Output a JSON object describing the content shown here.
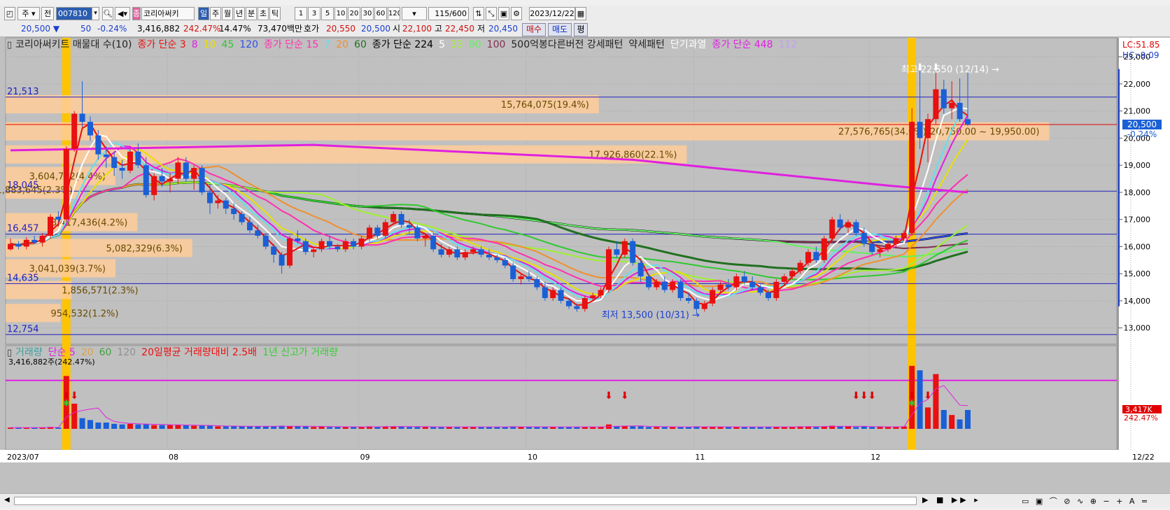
{
  "toolbar": {
    "period": "주",
    "mode": "전",
    "code": "007810",
    "name": "코리아써키",
    "timeframes": [
      "일",
      "주",
      "월",
      "년",
      "분",
      "초",
      "틱"
    ],
    "numbers": [
      "1",
      "3",
      "5",
      "10",
      "20",
      "30",
      "60",
      "120"
    ],
    "count": "115",
    "count_total": "/600",
    "date": "2023/12/22"
  },
  "quote": {
    "price": "20,500",
    "change": "50",
    "change_pct": "-0.24%",
    "volume": "3,416,882",
    "vol_ratio": "242.47%",
    "turnover": "14.47%",
    "amount": "73,470백만",
    "hoga_label": "호가",
    "ask": "20,550",
    "bid": "20,500",
    "open_label": "시",
    "open": "22,100",
    "high_label": "고",
    "high": "22,450",
    "low_label": "저",
    "low": "20,450",
    "buy": "매수",
    "sell": "매도",
    "flat": "평"
  },
  "legend_price": [
    {
      "text": "코리아써키트 매물대 수(10)",
      "color": "#222222"
    },
    {
      "text": "종가 단순 3",
      "color": "#e81010"
    },
    {
      "text": "8",
      "color": "#e020e0"
    },
    {
      "text": "10",
      "color": "#e8e000"
    },
    {
      "text": "45",
      "color": "#30c830"
    },
    {
      "text": "120",
      "color": "#3050f0"
    },
    {
      "text": "종가 단순 15",
      "color": "#ff30b0"
    },
    {
      "text": "7",
      "color": "#60e0f0"
    },
    {
      "text": "20",
      "color": "#f09030"
    },
    {
      "text": "60",
      "color": "#207020"
    },
    {
      "text": "종가 단순 224",
      "color": "#000000"
    },
    {
      "text": "5",
      "color": "#ffffff"
    },
    {
      "text": "33",
      "color": "#a0f030"
    },
    {
      "text": "90",
      "color": "#60f060"
    },
    {
      "text": "100",
      "color": "#803050"
    },
    {
      "text": "500억봉다른버전 강세패턴",
      "color": "#222222"
    },
    {
      "text": "약세패턴",
      "color": "#222222"
    },
    {
      "text": "단기과열",
      "color": "#ffffff"
    },
    {
      "text": "종가 단순 448",
      "color": "#e020e0"
    },
    {
      "text": "112",
      "color": "#c0a0f0"
    }
  ],
  "legend_volume": [
    {
      "text": "거래량",
      "color": "#40a0a0"
    },
    {
      "text": "단순 5",
      "color": "#e020e0"
    },
    {
      "text": "20",
      "color": "#e0a040"
    },
    {
      "text": "60",
      "color": "#40a040"
    },
    {
      "text": "120",
      "color": "#909090"
    },
    {
      "text": "20일평균 거래량대비 2.5배",
      "color": "#e81010"
    },
    {
      "text": "1년 신고가 거래량",
      "color": "#30d030"
    }
  ],
  "vol_info": "3,416,882주(242.47%)",
  "corner": {
    "lc": "LC:51.85",
    "hc": "HC:-9.09"
  },
  "chart_data": {
    "type": "candlestick",
    "x_labels": [
      "2023/07",
      "08",
      "09",
      "10",
      "11",
      "12",
      "12/22"
    ],
    "y_ticks": [
      13000,
      14000,
      15000,
      16000,
      17000,
      18000,
      19000,
      20000,
      21000,
      22000,
      23000
    ],
    "ylim": [
      12400,
      23700
    ],
    "current": {
      "price": "20,500",
      "pct": "-0.24%",
      "value": 20500
    },
    "hlines": [
      {
        "label": "21,513",
        "value": 21513
      },
      {
        "label": "18,045",
        "value": 18045
      },
      {
        "label": "16,457",
        "value": 16457
      },
      {
        "label": "14,635",
        "value": 14635
      },
      {
        "label": "12,754",
        "value": 12754
      }
    ],
    "profile": [
      {
        "value": 21250,
        "width": 0.54,
        "label": "15,764,075(19.4%)"
      },
      {
        "value": 20250,
        "width": 0.95,
        "label": "27,576,765(34.0%)(20,750.00 ~ 19,950.00)"
      },
      {
        "value": 19400,
        "width": 0.62,
        "label": "17,926,860(22.1%)"
      },
      {
        "value": 18100,
        "width": 0.07,
        "label": "1,883,645(2.3%)"
      },
      {
        "value": 16900,
        "width": 0.12,
        "label": "3,417,436(4.2%)"
      },
      {
        "value": 15950,
        "width": 0.17,
        "label": "5,082,329(6.3%)"
      },
      {
        "value": 15200,
        "width": 0.1,
        "label": "3,041,039(3.7%)"
      },
      {
        "value": 14400,
        "width": 0.06,
        "label": "1,856,571(2.3%)"
      },
      {
        "value": 13550,
        "width": 0.05,
        "label": "954,532(1.2%)"
      },
      {
        "value": 18600,
        "width": 0.1,
        "label": "3,604,792(4.4%)"
      }
    ],
    "annotations": {
      "high": "최고 22,550 (12/14)",
      "low": "최저 13,500 (10/31)"
    },
    "vol_label": "3,417K",
    "vol_pct": "242.47%",
    "candles": [
      [
        15900,
        16300,
        15850,
        16100
      ],
      [
        16100,
        16200,
        15900,
        16000
      ],
      [
        16000,
        16350,
        15900,
        16250
      ],
      [
        16250,
        16400,
        16100,
        16150
      ],
      [
        16150,
        16500,
        16000,
        16400
      ],
      [
        16400,
        17200,
        16300,
        17100
      ],
      [
        17100,
        17300,
        16900,
        17000
      ],
      [
        17000,
        19700,
        16900,
        19600
      ],
      [
        19600,
        21000,
        19500,
        20900
      ],
      [
        20900,
        22100,
        20400,
        20600
      ],
      [
        20600,
        20800,
        19900,
        20100
      ],
      [
        20100,
        20300,
        19200,
        19400
      ],
      [
        19400,
        19700,
        18900,
        19300
      ],
      [
        19300,
        19500,
        18600,
        18900
      ],
      [
        18900,
        19200,
        18500,
        18800
      ],
      [
        18800,
        19600,
        18700,
        19500
      ],
      [
        19500,
        19800,
        18900,
        19000
      ],
      [
        19000,
        19300,
        17800,
        17900
      ],
      [
        17900,
        18700,
        17700,
        18600
      ],
      [
        18600,
        18900,
        18200,
        18400
      ],
      [
        18400,
        18700,
        18000,
        18500
      ],
      [
        18500,
        19300,
        18300,
        19100
      ],
      [
        19100,
        19300,
        18400,
        18500
      ],
      [
        18500,
        19000,
        18100,
        18900
      ],
      [
        18900,
        19000,
        17900,
        18000
      ],
      [
        18000,
        18300,
        17200,
        17600
      ],
      [
        17600,
        17900,
        17400,
        17700
      ],
      [
        17700,
        17800,
        17200,
        17400
      ],
      [
        17400,
        17600,
        17000,
        17200
      ],
      [
        17200,
        17300,
        16800,
        16900
      ],
      [
        16900,
        17100,
        16500,
        16600
      ],
      [
        16600,
        16800,
        16300,
        16400
      ],
      [
        16400,
        16500,
        15900,
        16000
      ],
      [
        16000,
        16100,
        15400,
        15700
      ],
      [
        15700,
        15800,
        15000,
        15300
      ],
      [
        15300,
        16400,
        15200,
        16300
      ],
      [
        16300,
        16600,
        16100,
        16200
      ],
      [
        16200,
        16300,
        15700,
        15800
      ],
      [
        15800,
        16000,
        15600,
        15900
      ],
      [
        15900,
        16300,
        15800,
        16200
      ],
      [
        16200,
        16400,
        15900,
        16000
      ],
      [
        16000,
        16100,
        15800,
        15900
      ],
      [
        15900,
        16300,
        15800,
        16200
      ],
      [
        16200,
        16300,
        15900,
        16000
      ],
      [
        16000,
        16400,
        15900,
        16300
      ],
      [
        16300,
        16800,
        16200,
        16700
      ],
      [
        16700,
        16800,
        16300,
        16400
      ],
      [
        16400,
        17000,
        16300,
        16900
      ],
      [
        16900,
        17300,
        16800,
        17200
      ],
      [
        17200,
        17300,
        16700,
        16800
      ],
      [
        16800,
        17000,
        16500,
        16700
      ],
      [
        16700,
        16800,
        16200,
        16300
      ],
      [
        16300,
        16500,
        16000,
        16400
      ],
      [
        16400,
        16500,
        15800,
        15900
      ],
      [
        15900,
        16100,
        15600,
        15700
      ],
      [
        15700,
        16000,
        15600,
        15900
      ],
      [
        15900,
        16000,
        15500,
        15600
      ],
      [
        15600,
        15900,
        15500,
        15800
      ],
      [
        15800,
        16000,
        15700,
        15900
      ],
      [
        15900,
        16000,
        15600,
        15700
      ],
      [
        15700,
        15900,
        15500,
        15600
      ],
      [
        15600,
        15700,
        15400,
        15500
      ],
      [
        15500,
        15600,
        15200,
        15300
      ],
      [
        15300,
        15400,
        14700,
        14800
      ],
      [
        14800,
        15000,
        14600,
        14900
      ],
      [
        14900,
        15100,
        14700,
        14800
      ],
      [
        14800,
        14900,
        14400,
        14500
      ],
      [
        14500,
        14700,
        14000,
        14100
      ],
      [
        14100,
        14500,
        14000,
        14400
      ],
      [
        14400,
        14500,
        13900,
        14000
      ],
      [
        14000,
        14100,
        13700,
        13800
      ],
      [
        13800,
        13900,
        13600,
        13700
      ],
      [
        13700,
        14200,
        13600,
        14100
      ],
      [
        14100,
        14300,
        14000,
        14200
      ],
      [
        14200,
        14500,
        14100,
        14400
      ],
      [
        14400,
        16000,
        14300,
        15900
      ],
      [
        15900,
        16200,
        15600,
        15700
      ],
      [
        15700,
        16300,
        15600,
        16200
      ],
      [
        16200,
        16300,
        15300,
        15400
      ],
      [
        15400,
        15500,
        14700,
        14900
      ],
      [
        14900,
        15000,
        14400,
        14500
      ],
      [
        14500,
        14800,
        14400,
        14700
      ],
      [
        14700,
        14900,
        14300,
        14400
      ],
      [
        14400,
        14800,
        14300,
        14700
      ],
      [
        14700,
        14800,
        14000,
        14100
      ],
      [
        14100,
        14300,
        13900,
        14000
      ],
      [
        14000,
        14100,
        13500,
        13700
      ],
      [
        13700,
        14000,
        13600,
        13900
      ],
      [
        13900,
        14500,
        13800,
        14400
      ],
      [
        14400,
        14700,
        14300,
        14600
      ],
      [
        14600,
        14800,
        14400,
        14500
      ],
      [
        14500,
        15000,
        14400,
        14900
      ],
      [
        14900,
        15100,
        14600,
        14700
      ],
      [
        14700,
        14900,
        14400,
        14500
      ],
      [
        14500,
        14600,
        14200,
        14300
      ],
      [
        14300,
        14400,
        14000,
        14100
      ],
      [
        14100,
        14800,
        14000,
        14700
      ],
      [
        14700,
        15000,
        14600,
        14900
      ],
      [
        14900,
        15200,
        14800,
        15100
      ],
      [
        15100,
        15500,
        15000,
        15400
      ],
      [
        15400,
        15900,
        15300,
        15800
      ],
      [
        15800,
        16000,
        15400,
        15500
      ],
      [
        15500,
        16400,
        15400,
        16300
      ],
      [
        16300,
        17100,
        16200,
        17000
      ],
      [
        17000,
        17200,
        16600,
        16700
      ],
      [
        16700,
        17000,
        16500,
        16900
      ],
      [
        16900,
        17000,
        16400,
        16500
      ],
      [
        16500,
        16700,
        16000,
        16100
      ],
      [
        16100,
        16200,
        15700,
        15800
      ],
      [
        15800,
        16000,
        15600,
        15900
      ],
      [
        15900,
        16200,
        15800,
        16100
      ],
      [
        16100,
        16400,
        16000,
        16300
      ],
      [
        16300,
        16600,
        16200,
        16500
      ],
      [
        16500,
        21100,
        16400,
        20600
      ],
      [
        20600,
        22550,
        19600,
        20000
      ],
      [
        20000,
        20900,
        19100,
        20700
      ],
      [
        20700,
        22400,
        20500,
        21800
      ],
      [
        21800,
        22150,
        20900,
        21100
      ],
      [
        21100,
        22100,
        20700,
        21300
      ],
      [
        21300,
        22200,
        20600,
        20700
      ],
      [
        20700,
        22450,
        20450,
        20500
      ]
    ],
    "volumes": [
      0.02,
      0.02,
      0.02,
      0.02,
      0.02,
      0.03,
      0.02,
      0.84,
      0.4,
      0.17,
      0.14,
      0.1,
      0.1,
      0.08,
      0.07,
      0.08,
      0.07,
      0.08,
      0.06,
      0.06,
      0.06,
      0.06,
      0.06,
      0.05,
      0.05,
      0.05,
      0.04,
      0.04,
      0.04,
      0.04,
      0.04,
      0.04,
      0.04,
      0.04,
      0.05,
      0.04,
      0.04,
      0.04,
      0.03,
      0.04,
      0.03,
      0.03,
      0.03,
      0.03,
      0.03,
      0.04,
      0.03,
      0.04,
      0.04,
      0.04,
      0.03,
      0.03,
      0.03,
      0.03,
      0.03,
      0.03,
      0.03,
      0.03,
      0.03,
      0.03,
      0.03,
      0.03,
      0.03,
      0.04,
      0.03,
      0.03,
      0.03,
      0.03,
      0.03,
      0.03,
      0.03,
      0.03,
      0.03,
      0.03,
      0.03,
      0.07,
      0.04,
      0.05,
      0.04,
      0.04,
      0.03,
      0.03,
      0.03,
      0.03,
      0.03,
      0.03,
      0.04,
      0.03,
      0.03,
      0.03,
      0.03,
      0.03,
      0.03,
      0.03,
      0.03,
      0.03,
      0.03,
      0.03,
      0.03,
      0.04,
      0.04,
      0.03,
      0.04,
      0.05,
      0.04,
      0.04,
      0.03,
      0.04,
      0.03,
      0.03,
      0.03,
      0.03,
      0.04,
      1.0,
      0.93,
      0.34,
      0.87,
      0.3,
      0.22,
      0.15,
      0.3
    ],
    "arrow_days": [
      7,
      8,
      75,
      77,
      106,
      107,
      108,
      113,
      115
    ],
    "star_days": [
      7,
      113
    ],
    "highlight_days": [
      7,
      113
    ],
    "top_arrow_days": [
      114,
      116
    ]
  }
}
